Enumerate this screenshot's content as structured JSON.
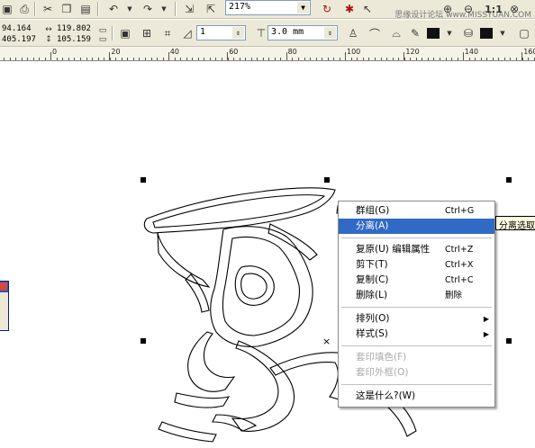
{
  "toolbar": {
    "zoom": "217%",
    "watermark": "思缘设计论坛 www.MISSYUAN.COM",
    "pos_x": "94.164",
    "pos_y": "405.197",
    "width": "119.802",
    "height": "105.159",
    "rotation": "1",
    "outline_width": "3.0 mm",
    "icons": [
      "save-icon",
      "print-icon",
      "cut-icon",
      "copy-icon",
      "paste-icon",
      "undo-icon",
      "redo-icon",
      "import-icon",
      "export-icon",
      "lock-icon",
      "convert-icon",
      "help-icon",
      "zoom-in-icon",
      "zoom-out-icon",
      "actual-size-icon",
      "zoom-fit-icon"
    ]
  },
  "ruler": {
    "labels": [
      "0",
      "20",
      "40",
      "60",
      "80",
      "100",
      "120",
      "140",
      "160"
    ]
  },
  "context_menu": {
    "items": [
      {
        "label": "群组(G)",
        "shortcut": "Ctrl+G",
        "state": "normal"
      },
      {
        "label": "分离(A)",
        "shortcut": "",
        "state": "highlighted"
      },
      {
        "sep": true
      },
      {
        "label": "复原(U) 编辑属性",
        "shortcut": "Ctrl+Z",
        "state": "normal"
      },
      {
        "label": "剪下(T)",
        "shortcut": "Ctrl+X",
        "state": "normal"
      },
      {
        "label": "复制(C)",
        "shortcut": "Ctrl+C",
        "state": "normal"
      },
      {
        "label": "删除(L)",
        "shortcut": "删除",
        "state": "normal"
      },
      {
        "sep": true
      },
      {
        "label": "排列(O)",
        "shortcut": "",
        "state": "submenu"
      },
      {
        "label": "样式(S)",
        "shortcut": "",
        "state": "submenu"
      },
      {
        "sep": true
      },
      {
        "label": "套印填色(F)",
        "shortcut": "",
        "state": "disabled"
      },
      {
        "label": "套印外框(O)",
        "shortcut": "",
        "state": "disabled"
      },
      {
        "sep": true
      },
      {
        "label": "这是什么?(W)",
        "shortcut": "",
        "state": "normal"
      }
    ]
  },
  "tooltip": "分离选取",
  "colors": {
    "highlight": "#316ac5",
    "toolbar_bg": "#ece9d8",
    "ruler_bg": "#f5f3e7"
  }
}
